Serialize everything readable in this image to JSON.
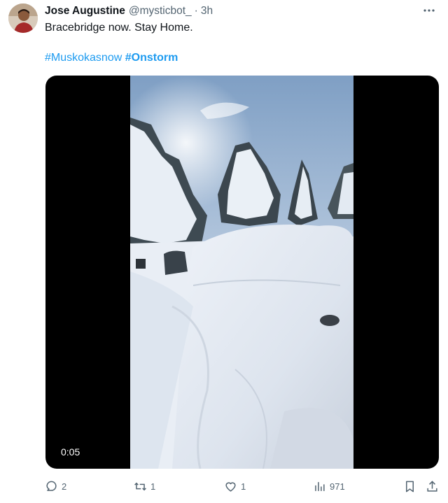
{
  "tweet": {
    "author": {
      "display_name": "Jose Augustine",
      "handle": "@mysticbot_",
      "separator": "·",
      "time": "3h"
    },
    "text": "Bracebridge now. Stay Home.",
    "hashtags": [
      "#Muskokasnow",
      "#Onstorm"
    ],
    "media": {
      "duration": "0:05",
      "content": "video of deep snow covering cars and snow-laden trees"
    },
    "metrics": {
      "replies": "2",
      "retweets": "1",
      "likes": "1",
      "views": "971"
    }
  },
  "colors": {
    "text": "#0f1419",
    "secondary": "#536471",
    "link": "#1d9bf0",
    "media_bg": "#000000"
  },
  "icons": {
    "more": "more-horizontal-icon",
    "reply": "reply-icon",
    "retweet": "retweet-icon",
    "like": "heart-icon",
    "views": "views-chart-icon",
    "bookmark": "bookmark-icon",
    "share": "share-icon"
  }
}
